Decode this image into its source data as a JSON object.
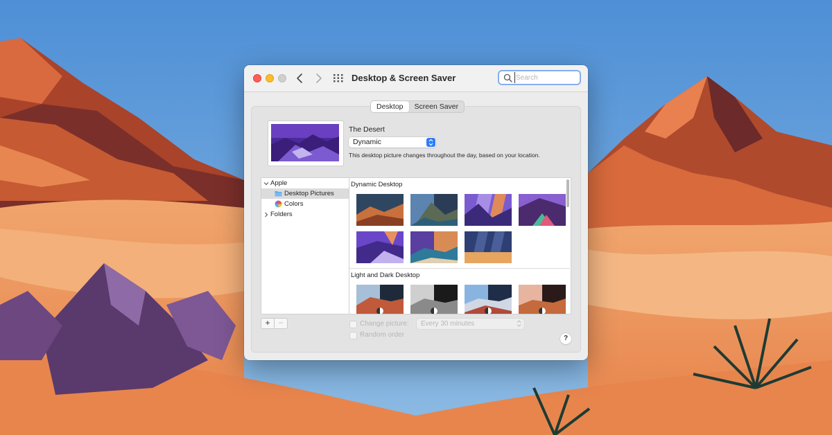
{
  "window": {
    "title": "Desktop & Screen Saver",
    "search_placeholder": "Search"
  },
  "tabs": [
    "Desktop",
    "Screen Saver"
  ],
  "selected_tab": "Desktop",
  "current_picture": {
    "name": "The Desert",
    "mode": "Dynamic",
    "description": "This desktop picture changes throughout the day, based on your location."
  },
  "sidebar": {
    "items": [
      {
        "label": "Apple",
        "expanded": true
      },
      {
        "label": "Desktop Pictures",
        "selected": true,
        "icon": "folder-icon"
      },
      {
        "label": "Colors",
        "icon": "color-wheel-icon"
      },
      {
        "label": "Folders",
        "expanded": false
      }
    ],
    "add_label": "+",
    "remove_label": "−"
  },
  "picture_grid": {
    "sections": [
      {
        "title": "Dynamic Desktop",
        "count": 7
      },
      {
        "title": "Light and Dark Desktop",
        "count": 4
      }
    ]
  },
  "options": {
    "change_picture_label": "Change picture:",
    "change_picture_interval": "Every 30 minutes",
    "random_order_label": "Random order",
    "help_label": "?"
  },
  "colors": {
    "accent": "#2f7cf6",
    "close": "#fe5f57",
    "minimize": "#febc2e"
  }
}
